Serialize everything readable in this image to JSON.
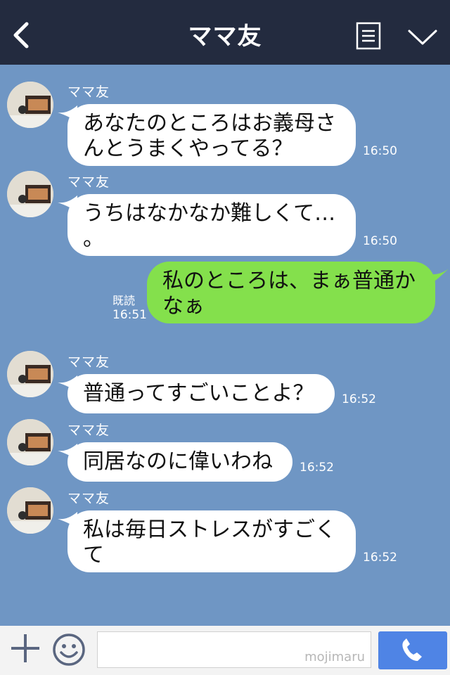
{
  "header": {
    "title": "ママ友",
    "back_icon": "chevron-left-icon",
    "menu_icon": "list-icon",
    "collapse_icon": "chevron-down-icon",
    "background": "#232b3f"
  },
  "chat": {
    "background": "#6f96c4",
    "incoming_color": "#ffffff",
    "outgoing_color": "#84e04c",
    "messages": [
      {
        "sender": "ママ友",
        "line1": "あなたのところはお義母さ",
        "line2": "んとうまくやってる？",
        "time": "16:50"
      },
      {
        "sender": "ママ友",
        "line1": "うちはなかなか難しくて…",
        "line2": "。",
        "time": "16:50"
      },
      {
        "sender": "me",
        "line1": "私のところは、まぁ普通か",
        "line2": "なぁ",
        "read": "既読",
        "time": "16:51"
      },
      {
        "sender": "ママ友",
        "line1": "普通ってすごいことよ？",
        "time": "16:52"
      },
      {
        "sender": "ママ友",
        "line1": "同居なのに偉いわね",
        "time": "16:52"
      },
      {
        "sender": "ママ友",
        "line1": "私は毎日ストレスがすごく",
        "line2": "て",
        "time": "16:52"
      }
    ]
  },
  "input_bar": {
    "plus_icon": "plus-icon",
    "emoji_icon": "smiley-icon",
    "placeholder": "",
    "watermark": "mojimaru",
    "call_icon": "phone-icon",
    "call_button_color": "#4f84e5"
  }
}
